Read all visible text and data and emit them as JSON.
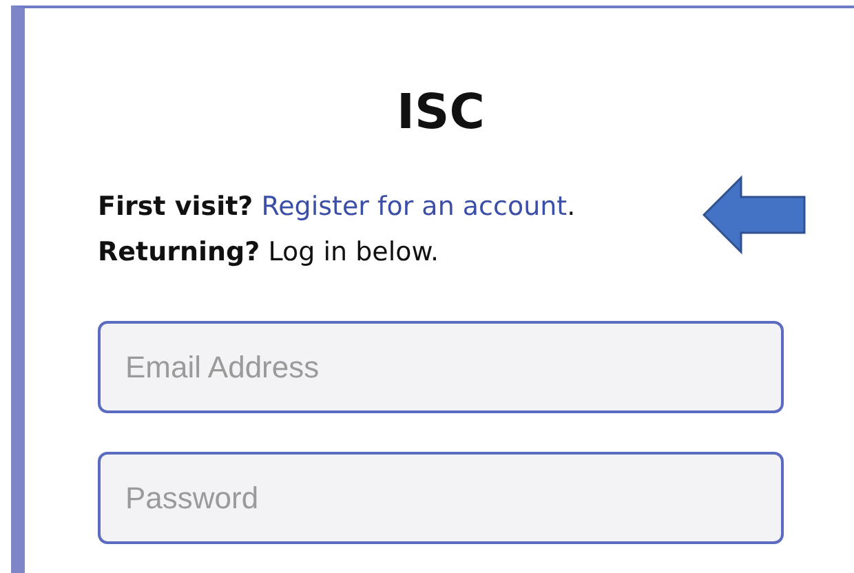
{
  "title": "ISC",
  "lines": [
    {
      "bold": "First visit?",
      "link": "Register for an account",
      "tail": "."
    },
    {
      "bold": "Returning?",
      "tail": "Log in below."
    }
  ],
  "fields": [
    {
      "placeholder": "Email Address"
    },
    {
      "placeholder": "Password"
    }
  ]
}
